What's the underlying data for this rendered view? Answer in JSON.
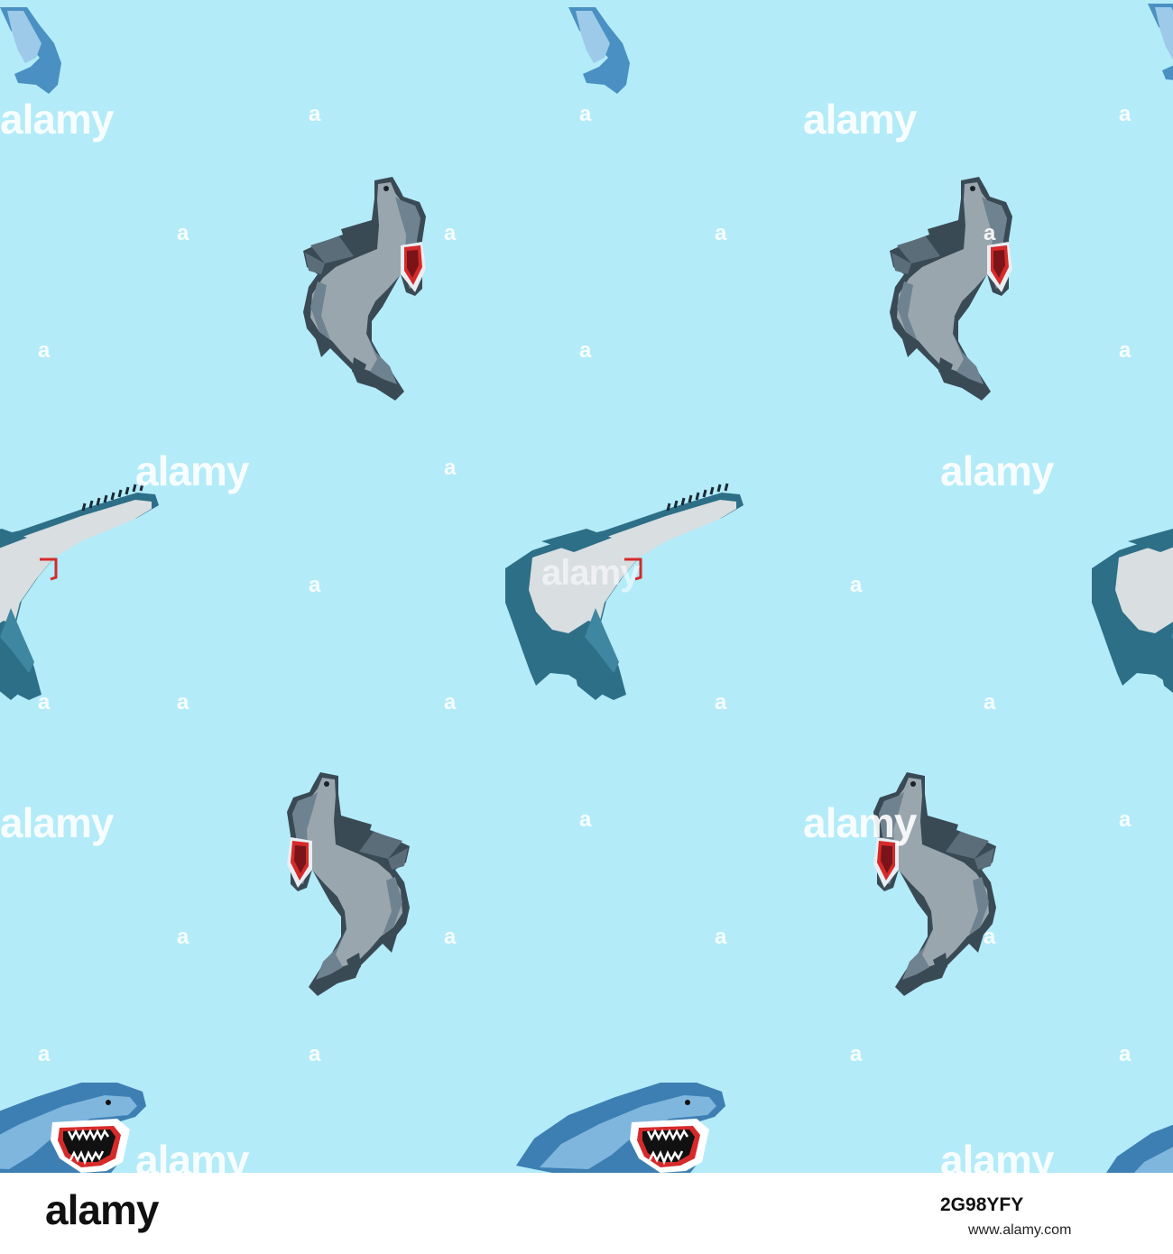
{
  "image": {
    "subject": "seamless pattern of pixel-art sharks",
    "background_color": "#b3ebf9",
    "shark_types": [
      "hammerhead-shark",
      "sawfish-shark",
      "great-white-shark"
    ]
  },
  "watermark": {
    "word": "alamy",
    "letter": "a",
    "color": "#ffffff"
  },
  "footer": {
    "logo": "alamy",
    "image_id": "2G98YFY",
    "url": "www.alamy.com"
  }
}
